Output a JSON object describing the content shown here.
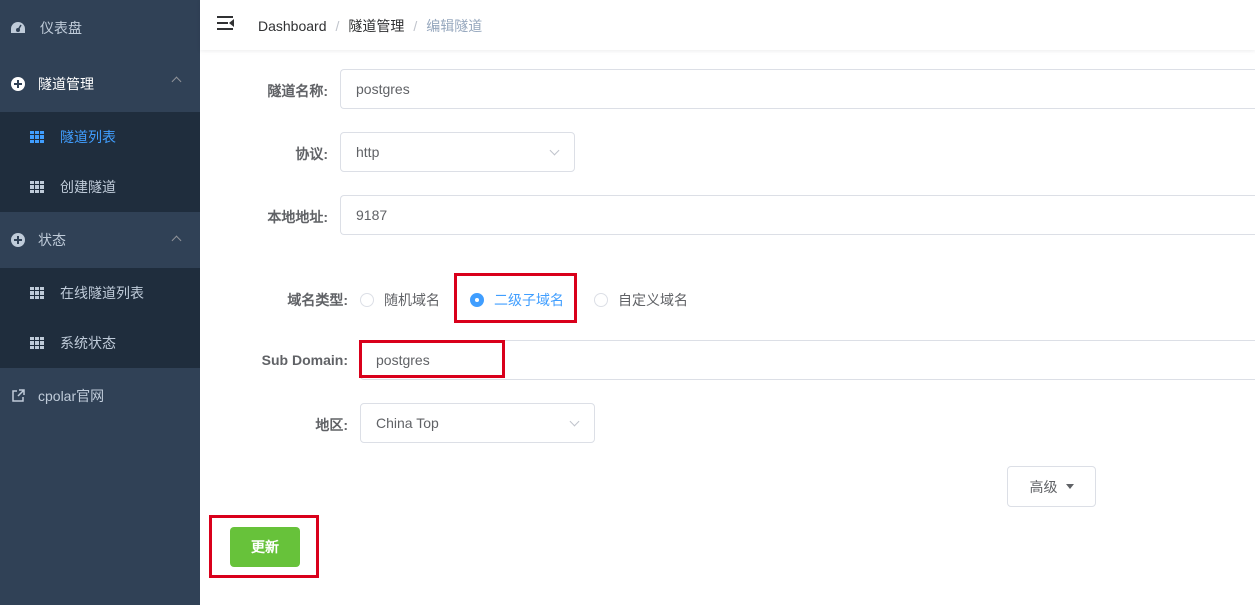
{
  "sidebar": {
    "dashboard": {
      "label": "仪表盘",
      "icon": "speedometer-icon"
    },
    "tunnel_mgmt": {
      "label": "隧道管理",
      "icon": "plus-circle-icon",
      "items": [
        {
          "label": "隧道列表",
          "icon": "table-icon",
          "active": true
        },
        {
          "label": "创建隧道",
          "icon": "table-icon",
          "active": false
        }
      ]
    },
    "status": {
      "label": "状态",
      "icon": "plus-circle-icon",
      "items": [
        {
          "label": "在线隧道列表",
          "icon": "table-icon"
        },
        {
          "label": "系统状态",
          "icon": "table-icon"
        }
      ]
    },
    "official_site": {
      "label": "cpolar官网",
      "icon": "external-link-icon"
    }
  },
  "header": {
    "breadcrumb": [
      "Dashboard",
      "隧道管理",
      "编辑隧道"
    ]
  },
  "form": {
    "tunnel_name": {
      "label": "隧道名称:",
      "value": "postgres"
    },
    "protocol": {
      "label": "协议:",
      "value": "http"
    },
    "local_addr": {
      "label": "本地地址:",
      "value": "9187"
    },
    "domain_type": {
      "label": "域名类型:",
      "options": [
        "随机域名",
        "二级子域名",
        "自定义域名"
      ],
      "selected": "二级子域名"
    },
    "sub_domain": {
      "label": "Sub Domain:",
      "value": "postgres"
    },
    "region": {
      "label": "地区:",
      "value": "China Top"
    },
    "advanced_label": "高级",
    "submit_label": "更新"
  },
  "colors": {
    "sidebar_bg": "#304156",
    "submenu_bg": "#1f2d3d",
    "active": "#409eff",
    "success": "#67c23a",
    "highlight": "#d9001b"
  }
}
